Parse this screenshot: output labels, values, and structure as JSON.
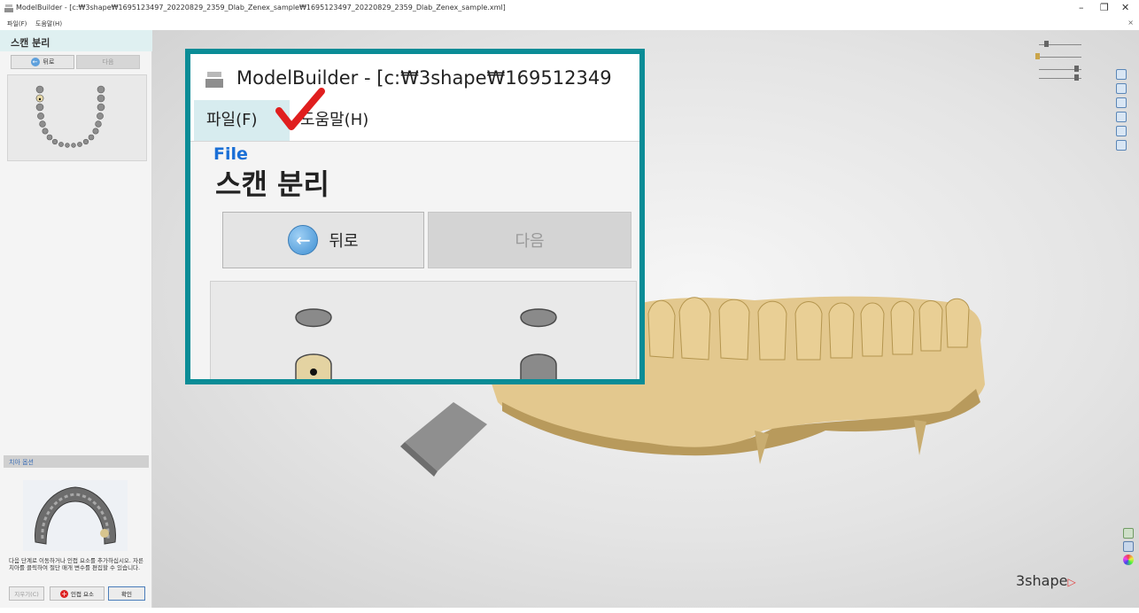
{
  "window": {
    "title": "ModelBuilder - [c:₩3shape₩1695123497_20220829_2359_Dlab_Zenex_sample₩1695123497_20220829_2359_Dlab_Zenex_sample.xml]",
    "minimize": "–",
    "restore": "❐",
    "close": "✕"
  },
  "menu": {
    "file": "파일(F)",
    "help": "도움말(H)",
    "close_doc": "×"
  },
  "left_panel": {
    "step_title": "스캔 분리",
    "back_label": "뒤로",
    "back_arrow": "←",
    "next_label": "다음",
    "section_header": "치아 옵션",
    "instructions": "다음 단계로 이동하거나 인접 요소를 추가하십시오. 자른 치아를 클릭하여 절단 매개 변수를 편집할 수 있습니다.",
    "btn_clear": "지우기(C)",
    "btn_adjacent": "인접 요소",
    "btn_confirm": "확인"
  },
  "viewport": {
    "brand": "3shape",
    "brand_arrow": "▷",
    "colors": {
      "model": "#e3c88e",
      "model_shade": "#b89a5c",
      "stand": "#8a8a8a"
    }
  },
  "callout": {
    "title": "ModelBuilder - [c:₩3shape₩169512349",
    "file_menu": "파일(F)",
    "help_menu": "도움말(H)",
    "annotation": "File",
    "step_title": "스캔 분리",
    "back_label": "뒤로",
    "back_arrow": "←",
    "next_label": "다음",
    "colors": {
      "border": "#0a8c96",
      "check": "#e01e1e",
      "annotation": "#1a6fd6"
    }
  }
}
